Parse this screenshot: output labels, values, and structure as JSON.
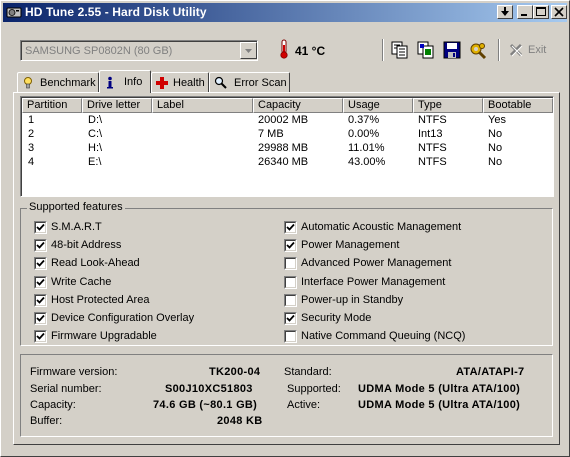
{
  "window": {
    "title": "HD Tune 2.55 - Hard Disk Utility",
    "title_icon": "hdtune-app-icon"
  },
  "toolbar": {
    "drive_selected": "SAMSUNG SP0802N (80 GB)",
    "temperature": "41 °C",
    "exit_label": "Exit",
    "icons": [
      "copy-text-icon",
      "copy-screenshot-icon",
      "save-icon",
      "options-icon"
    ]
  },
  "tabs": [
    {
      "label": "Benchmark",
      "icon": "benchmark-icon",
      "active": false
    },
    {
      "label": "Info",
      "icon": "info-icon",
      "active": true
    },
    {
      "label": "Health",
      "icon": "health-cross-icon",
      "active": false
    },
    {
      "label": "Error Scan",
      "icon": "magnifier-icon",
      "active": false
    }
  ],
  "partitions": {
    "columns": [
      "Partition",
      "Drive letter",
      "Label",
      "Capacity",
      "Usage",
      "Type",
      "Bootable"
    ],
    "rows": [
      [
        "1",
        "D:\\",
        "",
        "20002 MB",
        "0.37%",
        "NTFS",
        "Yes"
      ],
      [
        "2",
        "C:\\",
        "",
        "7 MB",
        "0.00%",
        "Int13",
        "No"
      ],
      [
        "3",
        "H:\\",
        "",
        "29988 MB",
        "11.01%",
        "NTFS",
        "No"
      ],
      [
        "4",
        "E:\\",
        "",
        "26340 MB",
        "43.00%",
        "NTFS",
        "No"
      ]
    ]
  },
  "features": {
    "title": "Supported features",
    "left": [
      {
        "label": "S.M.A.R.T",
        "checked": true
      },
      {
        "label": "48-bit Address",
        "checked": true
      },
      {
        "label": "Read Look-Ahead",
        "checked": true
      },
      {
        "label": "Write Cache",
        "checked": true
      },
      {
        "label": "Host Protected Area",
        "checked": true
      },
      {
        "label": "Device Configuration Overlay",
        "checked": true
      },
      {
        "label": "Firmware Upgradable",
        "checked": true
      }
    ],
    "right": [
      {
        "label": "Automatic Acoustic Management",
        "checked": true
      },
      {
        "label": "Power Management",
        "checked": true
      },
      {
        "label": "Advanced Power Management",
        "checked": false
      },
      {
        "label": "Interface Power Management",
        "checked": false
      },
      {
        "label": "Power-up in Standby",
        "checked": false
      },
      {
        "label": "Security Mode",
        "checked": true
      },
      {
        "label": "Native Command Queuing (NCQ)",
        "checked": false
      }
    ]
  },
  "info": {
    "firmware_label": "Firmware version:",
    "firmware": "TK200-04",
    "serial_label": "Serial number:",
    "serial": "S00J10XC51803",
    "capacity_label": "Capacity:",
    "capacity": "74.6 GB (~80.1 GB)",
    "buffer_label": "Buffer:",
    "buffer": "2048 KB",
    "standard_label": "Standard:",
    "standard": "ATA/ATAPI-7",
    "supported_label": "Supported:",
    "supported": "UDMA Mode 5 (Ultra ATA/100)",
    "active_label": "Active:",
    "active": "UDMA Mode 5 (Ultra ATA/100)"
  }
}
